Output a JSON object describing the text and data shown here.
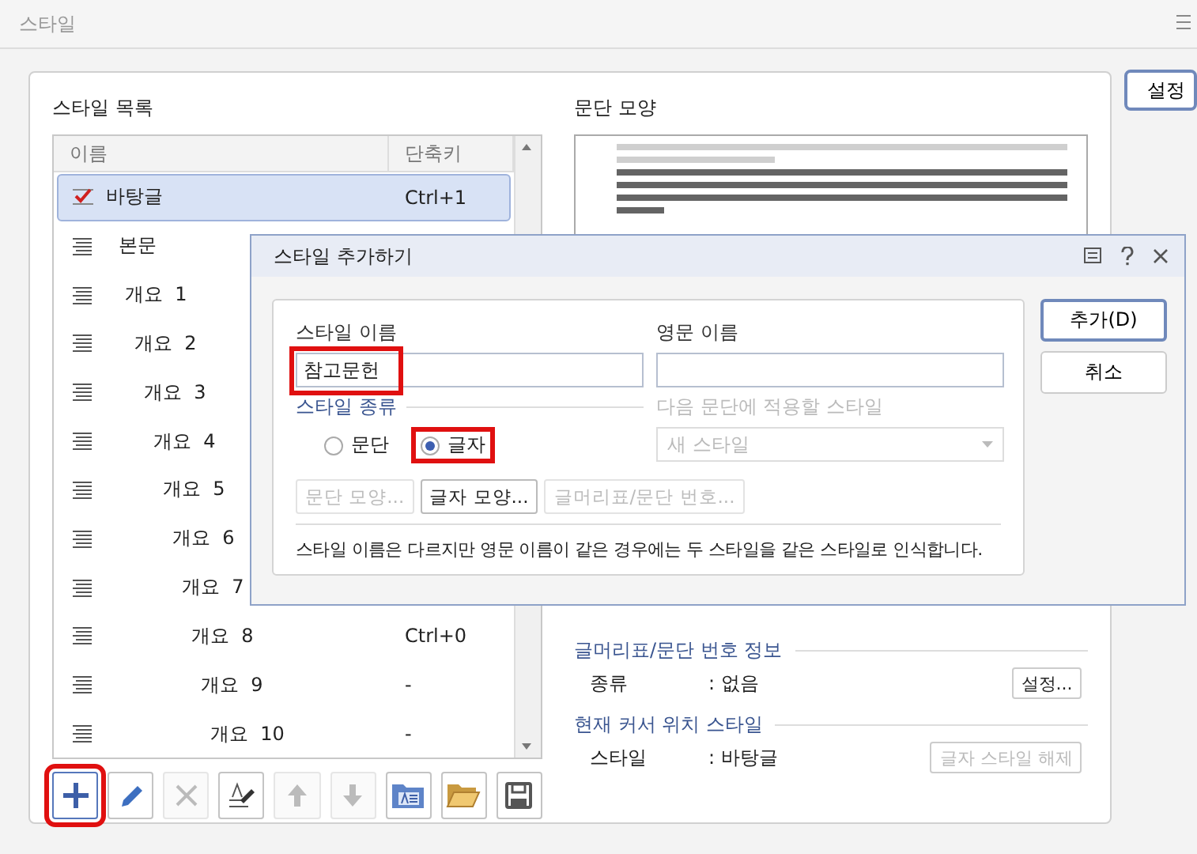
{
  "window": {
    "title": "스타일"
  },
  "style_list": {
    "title": "스타일 목록",
    "columns": [
      "이름",
      "단축키"
    ],
    "rows": [
      {
        "name": "바탕글",
        "shortcut": "Ctrl+1",
        "selected": true,
        "kind": "check"
      },
      {
        "name": "본문",
        "selected": false,
        "kind": "para"
      },
      {
        "name": "개요  1",
        "selected": false,
        "kind": "para"
      },
      {
        "name": "개요  2",
        "selected": false,
        "kind": "para"
      },
      {
        "name": "개요  3",
        "selected": false,
        "kind": "para"
      },
      {
        "name": "개요  4",
        "selected": false,
        "kind": "para"
      },
      {
        "name": "개요  5",
        "selected": false,
        "kind": "para"
      },
      {
        "name": "개요  6",
        "selected": false,
        "kind": "para"
      },
      {
        "name": "개요  7",
        "selected": false,
        "kind": "para"
      },
      {
        "name": "개요  8",
        "shortcut": "Ctrl+0",
        "selected": false,
        "kind": "para"
      },
      {
        "name": "개요  9",
        "shortcut": "-",
        "selected": false,
        "kind": "para"
      },
      {
        "name": "개요  10",
        "shortcut": "-",
        "selected": false,
        "kind": "para"
      }
    ]
  },
  "toolbar": [
    {
      "kind": "add",
      "disabled": false,
      "highlighted": true
    },
    {
      "kind": "edit",
      "disabled": false,
      "highlighted": false
    },
    {
      "kind": "delete",
      "disabled": true,
      "highlighted": false
    },
    {
      "kind": "picker",
      "disabled": false,
      "highlighted": false
    },
    {
      "kind": "up",
      "disabled": true,
      "highlighted": false
    },
    {
      "kind": "down",
      "disabled": true,
      "highlighted": false
    },
    {
      "kind": "import",
      "disabled": false,
      "highlighted": false
    },
    {
      "kind": "open",
      "disabled": false,
      "highlighted": false
    },
    {
      "kind": "save",
      "disabled": false,
      "highlighted": false
    }
  ],
  "preview": {
    "title": "문단 모양"
  },
  "numbering_info": {
    "title": "글머리표/문단 번호 정보",
    "label": "종류",
    "value": ": 없음",
    "button": "설정..."
  },
  "cursor_style": {
    "title": "현재 커서 위치 스타일",
    "label": "스타일",
    "value": ": 바탕글",
    "button": "글자 스타일 해제",
    "button_disabled": true
  },
  "side_button": "설정",
  "dialog": {
    "title": "스타일 추가하기",
    "name_label": "스타일 이름",
    "name_value": "참고문헌",
    "name_highlighted": true,
    "english_label": "영문 이름",
    "type_label": "스타일 종류",
    "types": [
      {
        "label": "문단",
        "selected": false,
        "highlighted": false
      },
      {
        "label": "글자",
        "selected": true,
        "highlighted": true
      }
    ],
    "next_label": "다음 문단에 적용할 스타일",
    "next_value": "새 스타일",
    "buttons": [
      {
        "label": "문단 모양...",
        "disabled": true
      },
      {
        "label": "글자 모양...",
        "disabled": false
      },
      {
        "label": "글머리표/문단 번호...",
        "disabled": true
      }
    ],
    "note": "스타일 이름은 다르지만 영문 이름이 같은 경우에는 두 스타일을 같은 스타일로 인식합니다.",
    "actions": [
      {
        "label": "추가(D)",
        "primary": true
      },
      {
        "label": "취소",
        "primary": false
      }
    ]
  }
}
